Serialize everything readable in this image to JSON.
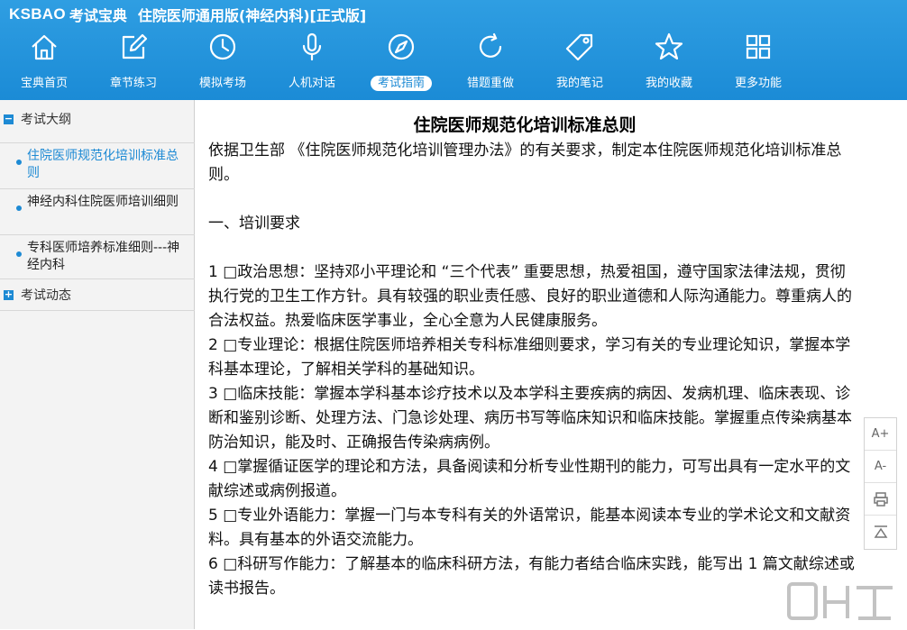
{
  "header": {
    "brand": "KSBAO",
    "brand_sub": "考试宝典",
    "app_title": "住院医师通用版(神经内科)[正式版]",
    "nav": [
      {
        "label": "宝典首页",
        "icon": "home-icon"
      },
      {
        "label": "章节练习",
        "icon": "edit-icon"
      },
      {
        "label": "模拟考场",
        "icon": "clock-icon"
      },
      {
        "label": "人机对话",
        "icon": "microphone-icon"
      },
      {
        "label": "考试指南",
        "icon": "compass-icon",
        "active": true
      },
      {
        "label": "错题重做",
        "icon": "refresh-icon"
      },
      {
        "label": "我的笔记",
        "icon": "tag-icon"
      },
      {
        "label": "我的收藏",
        "icon": "star-icon"
      },
      {
        "label": "更多功能",
        "icon": "grid-icon"
      }
    ]
  },
  "sidebar": {
    "sections": [
      {
        "label": "考试大纲",
        "state": "−"
      },
      {
        "label": "考试动态",
        "state": "+"
      }
    ],
    "items": [
      {
        "label": "住院医师规范化培训标准总则",
        "active": true
      },
      {
        "label": "神经内科住院医师培训细则"
      },
      {
        "label": "专科医师培养标准细则---神经内科"
      }
    ]
  },
  "document": {
    "title": "住院医师规范化培训标准总则",
    "intro": "依据卫生部 《住院医师规范化培训管理办法》的有关要求，制定本住院医师规范化培训标准总则。",
    "section1": "一、培训要求",
    "paragraphs": [
      " 1 □政治思想：坚持邓小平理论和 “三个代表” 重要思想，热爱祖国，遵守国家法律法规，贯彻执行党的卫生工作方针。具有较强的职业责任感、良好的职业道德和人际沟通能力。尊重病人的合法权益。热爱临床医学事业，全心全意为人民健康服务。",
      " 2 □专业理论：根据住院医师培养相关专科标准细则要求，学习有关的专业理论知识，掌握本学科基本理论，了解相关学科的基础知识。",
      " 3 □临床技能：掌握本学科基本诊疗技术以及本学科主要疾病的病因、发病机理、临床表现、诊断和鉴别诊断、处理方法、门急诊处理、病历书写等临床知识和临床技能。掌握重点传染病基本防治知识，能及时、正确报告传染病病例。",
      " 4 □掌握循证医学的理论和方法，具备阅读和分析专业性期刊的能力，可写出具有一定水平的文献综述或病例报道。",
      " 5 □专业外语能力：掌握一门与本专科有关的外语常识，能基本阅读本专业的学术论文和文献资料。具有基本的外语交流能力。",
      " 6 □科研写作能力：了解基本的临床科研方法，有能力者结合临床实践，能写出 1 篇文献综述或读书报告。"
    ]
  },
  "tools": {
    "font_up": "A+",
    "font_down": "A-"
  },
  "colors": {
    "header_blue": "#1b8bd6",
    "active_link": "#1d8ad4"
  }
}
